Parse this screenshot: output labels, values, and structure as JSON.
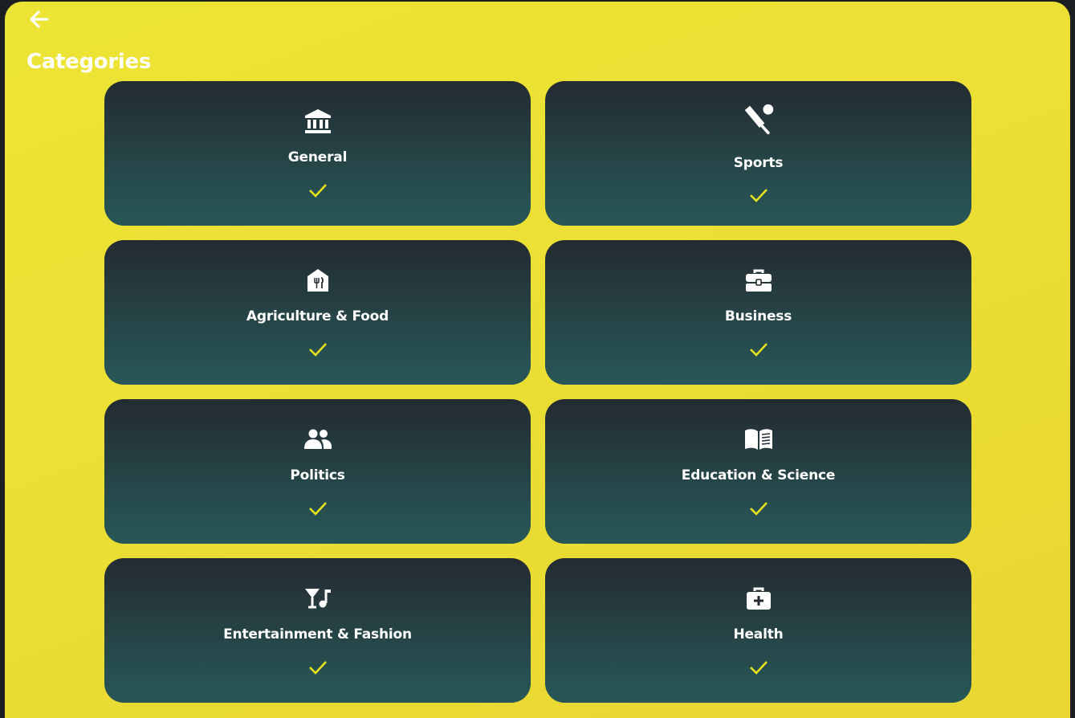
{
  "header": {
    "back_icon": "arrow-left-icon",
    "title": "Categories"
  },
  "colors": {
    "background": "#ebe033",
    "card_top": "#242b32",
    "card_bottom": "#285758",
    "check": "#e5e11d",
    "text": "#ffffff"
  },
  "categories": [
    {
      "label": "General",
      "icon": "bank-icon",
      "selected": true
    },
    {
      "label": "Sports",
      "icon": "cricket-icon",
      "selected": true
    },
    {
      "label": "Agriculture & Food",
      "icon": "food-house-icon",
      "selected": true
    },
    {
      "label": "Business",
      "icon": "briefcase-icon",
      "selected": true
    },
    {
      "label": "Politics",
      "icon": "people-icon",
      "selected": true
    },
    {
      "label": "Education & Science",
      "icon": "book-icon",
      "selected": true
    },
    {
      "label": "Entertainment & Fashion",
      "icon": "cocktail-music-icon",
      "selected": true
    },
    {
      "label": "Health",
      "icon": "medical-kit-icon",
      "selected": true
    }
  ]
}
